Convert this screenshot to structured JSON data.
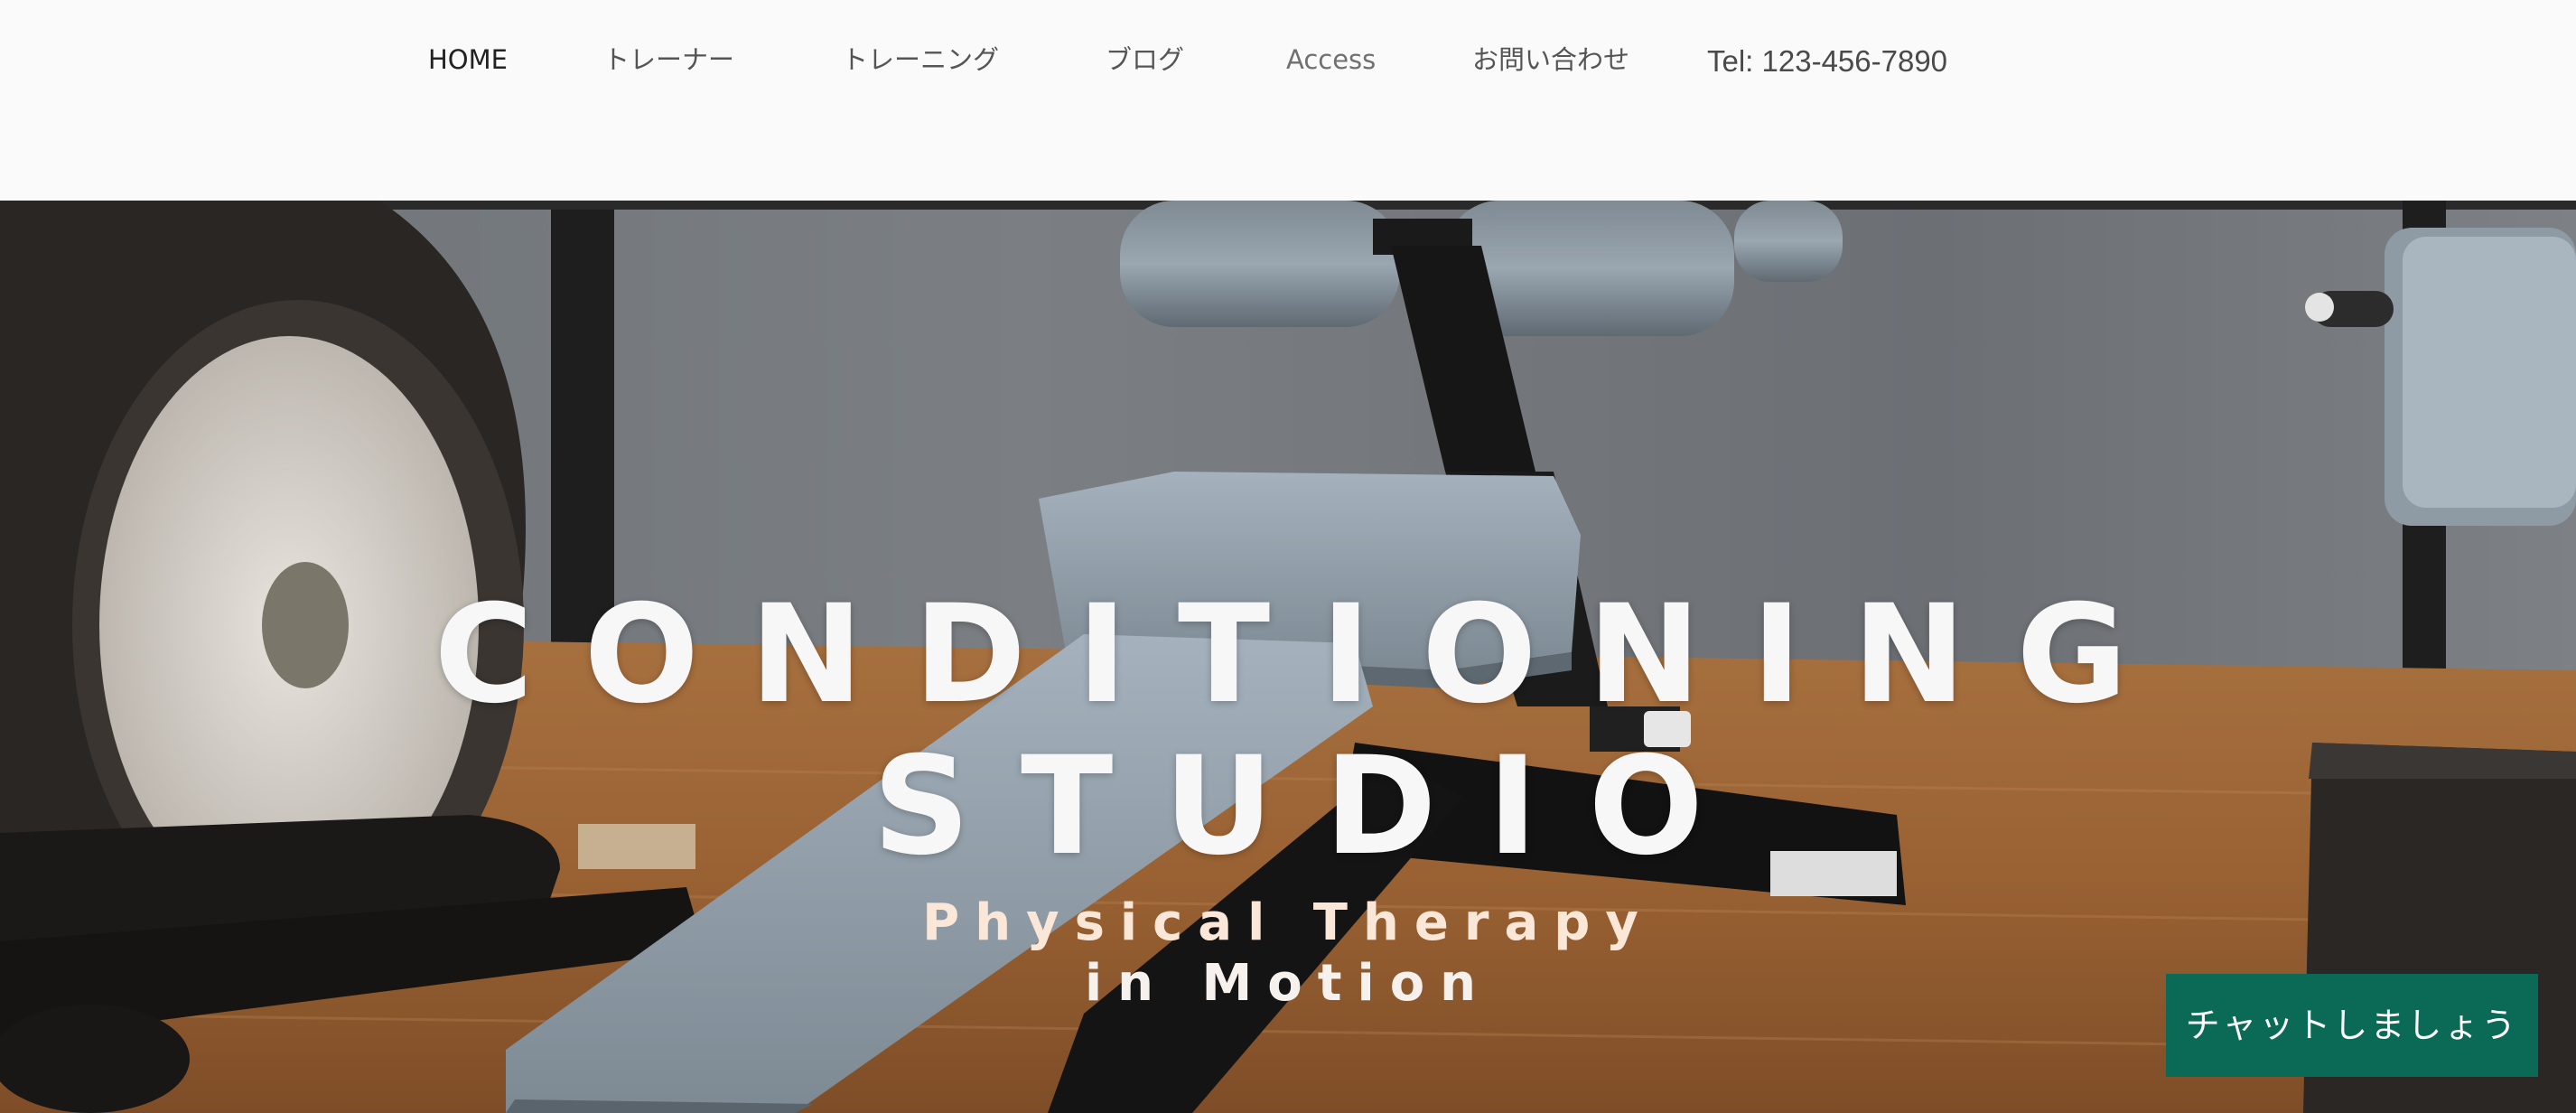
{
  "header": {
    "nav": [
      {
        "label": "HOME"
      },
      {
        "label": "トレーナー"
      },
      {
        "label": "トレーニング"
      },
      {
        "label": "ブログ"
      },
      {
        "label": "Access"
      },
      {
        "label": "お問い合わせ"
      }
    ],
    "tel": "Tel: 123-456-7890"
  },
  "hero": {
    "title_line1": "CONDITIONING",
    "title_line2": "STUDIO",
    "subtitle_line1": "Physical Therapy",
    "subtitle_line2": "in Motion"
  },
  "chat": {
    "label": "チャットしましょう"
  },
  "colors": {
    "chat_button": "#0a6a55",
    "background": "#fafafa"
  }
}
